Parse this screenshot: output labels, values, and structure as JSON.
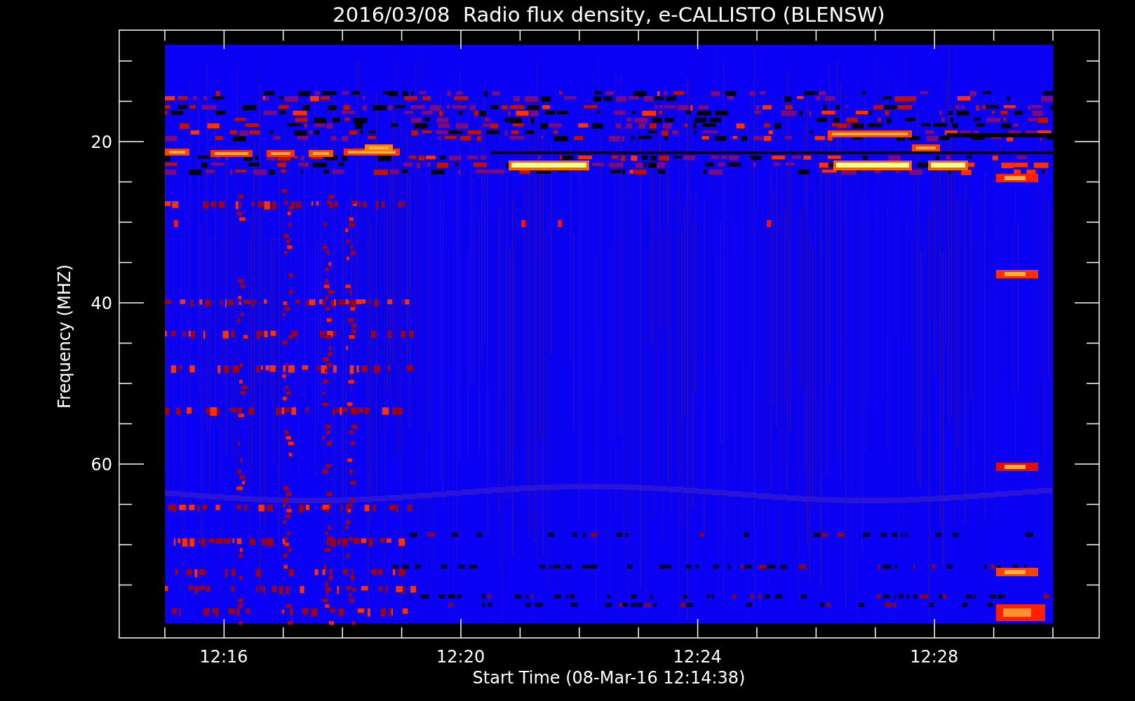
{
  "title": "2016/03/08  Radio flux density, e-CALLISTO (BLENSW)",
  "y_axis": {
    "label": "Frequency (MHZ)",
    "ticks": [
      "20",
      "40",
      "60"
    ]
  },
  "x_axis": {
    "label": "Start Time (08-Mar-16 12:14:38)",
    "ticks": [
      "12:16",
      "12:20",
      "12:24",
      "12:28"
    ]
  }
}
